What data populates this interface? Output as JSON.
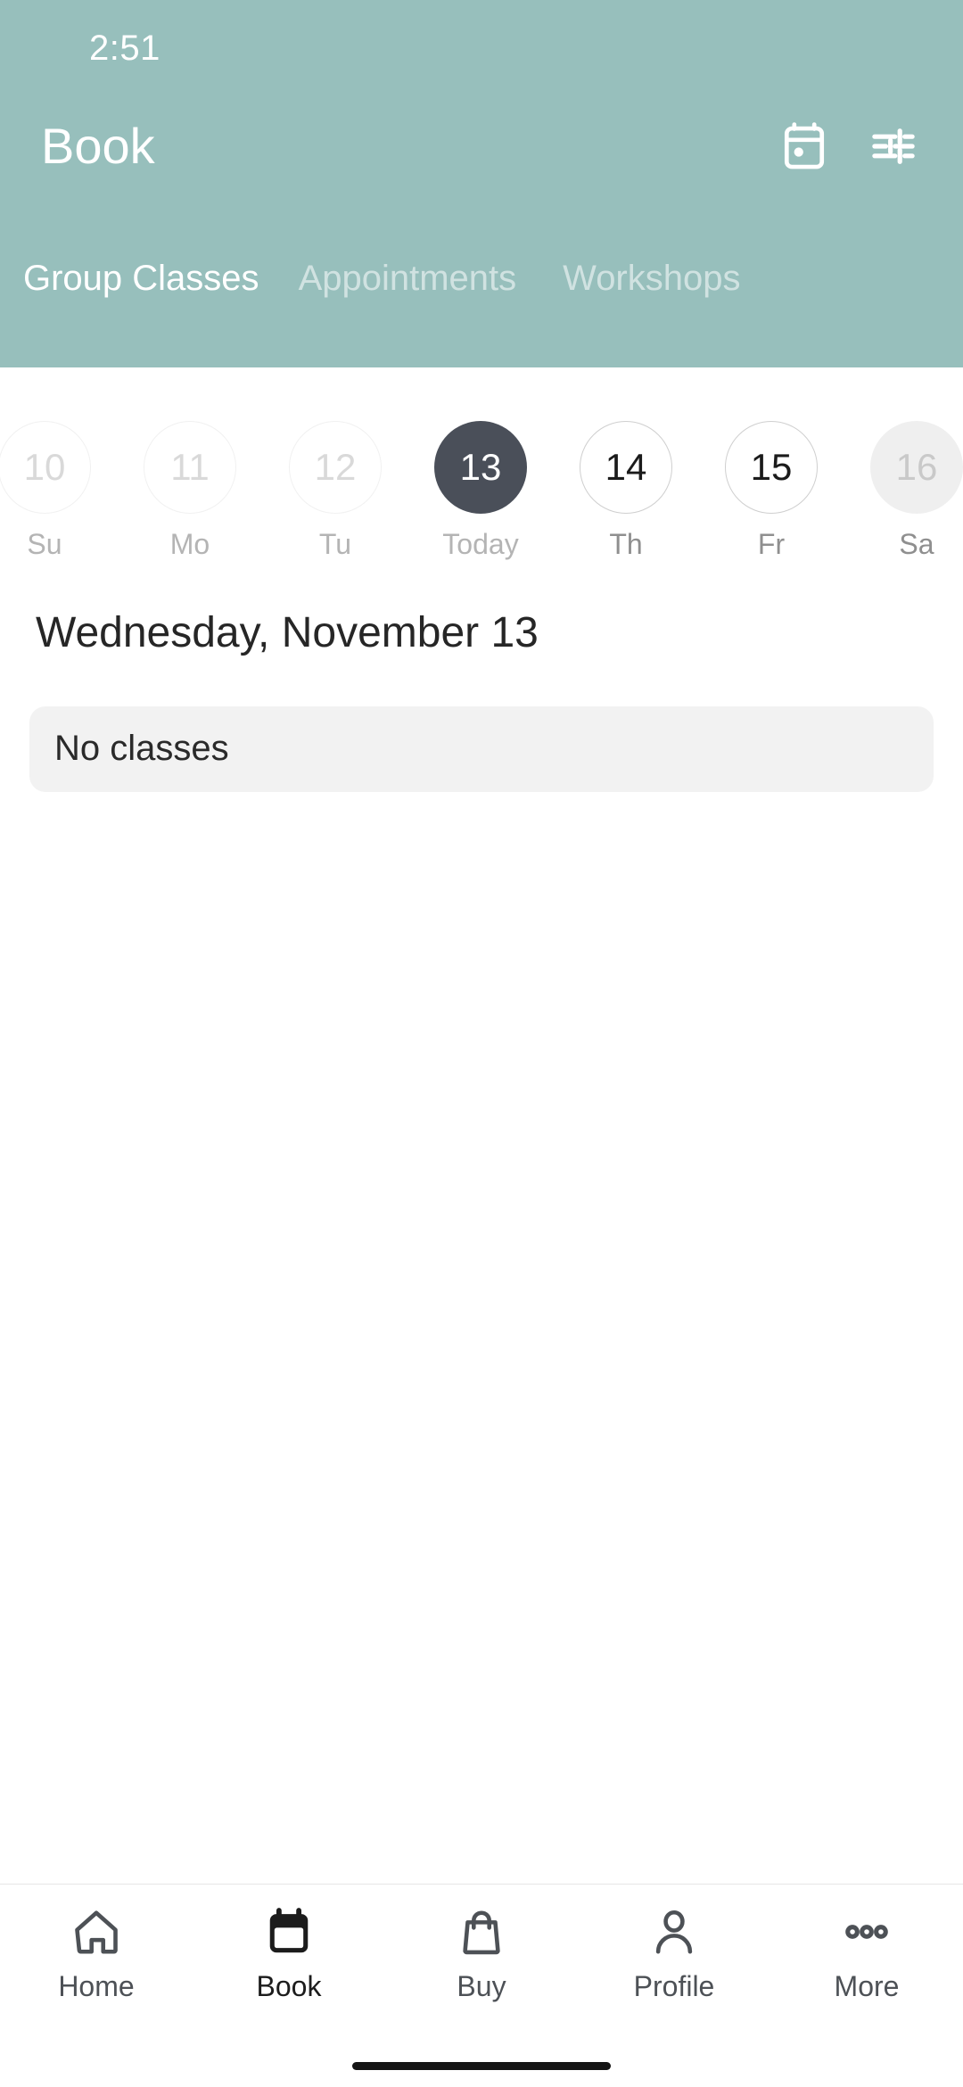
{
  "status_bar": {
    "time": "2:51"
  },
  "header": {
    "title": "Book",
    "accent_color": "#97bfbc",
    "actions": [
      {
        "name": "calendar-icon",
        "label": "Calendar"
      },
      {
        "name": "tune-icon",
        "label": "Filters"
      }
    ],
    "tabs": [
      {
        "label": "Group Classes",
        "active": true
      },
      {
        "label": "Appointments",
        "active": false
      },
      {
        "label": "Workshops",
        "active": false
      }
    ]
  },
  "date_strip": {
    "days": [
      {
        "date": "10",
        "weekday": "Su",
        "state": "past"
      },
      {
        "date": "11",
        "weekday": "Mo",
        "state": "past"
      },
      {
        "date": "12",
        "weekday": "Tu",
        "state": "past"
      },
      {
        "date": "13",
        "weekday": "Today",
        "state": "today"
      },
      {
        "date": "14",
        "weekday": "Th",
        "state": "future"
      },
      {
        "date": "15",
        "weekday": "Fr",
        "state": "future"
      },
      {
        "date": "16",
        "weekday": "Sa",
        "state": "disabled"
      }
    ]
  },
  "main": {
    "date_heading": "Wednesday, November 13",
    "empty_state": "No classes"
  },
  "bottom_nav": {
    "items": [
      {
        "label": "Home",
        "icon": "home-icon",
        "active": false
      },
      {
        "label": "Book",
        "icon": "calendar-filled-icon",
        "active": true
      },
      {
        "label": "Buy",
        "icon": "shopping-bag-icon",
        "active": false
      },
      {
        "label": "Profile",
        "icon": "person-icon",
        "active": false
      },
      {
        "label": "More",
        "icon": "more-horizontal-icon",
        "active": false
      }
    ]
  },
  "colors": {
    "accent": "#97bfbc",
    "today_chip": "#4a4f59",
    "card_bg": "#f2f2f2",
    "text_primary": "#262626",
    "text_muted": "#b4b4b4"
  }
}
